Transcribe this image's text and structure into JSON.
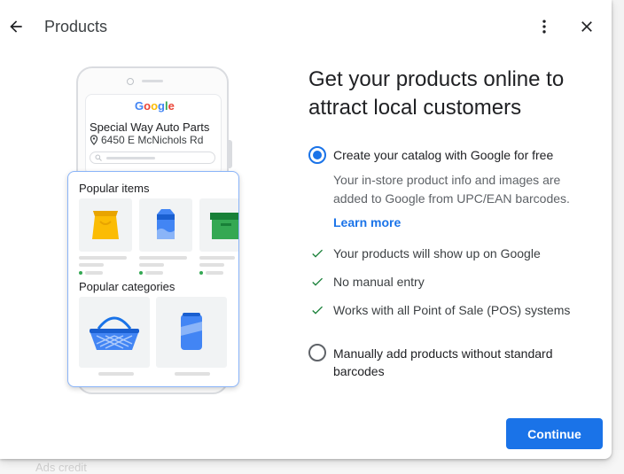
{
  "backdrop": {
    "hint_text": "Ads credit"
  },
  "dialog": {
    "title": "Products",
    "back_icon": "arrow-left-icon",
    "more_icon": "more-vert-icon",
    "close_icon": "close-icon"
  },
  "illustration": {
    "google_logo": "Google",
    "store_name": "Special Way Auto Parts",
    "store_address": "6450 E McNichols Rd",
    "popular_items_label": "Popular items",
    "popular_categories_label": "Popular categories"
  },
  "main": {
    "heading": "Get your products online to attract local customers",
    "option1": {
      "label": "Create your catalog with Google for free",
      "selected": true,
      "description": "Your in-store product info and images are added to Google from UPC/EAN barcodes.",
      "link": "Learn more"
    },
    "benefits": [
      "Your products will show up on Google",
      "No manual entry",
      "Works with all Point of Sale (POS) systems"
    ],
    "option2": {
      "label": "Manually add products without standard barcodes",
      "selected": false
    }
  },
  "footer": {
    "continue_label": "Continue"
  },
  "colors": {
    "accent": "#1a73e8",
    "check": "#188038",
    "text_primary": "#202124",
    "text_secondary": "#5f6368"
  }
}
